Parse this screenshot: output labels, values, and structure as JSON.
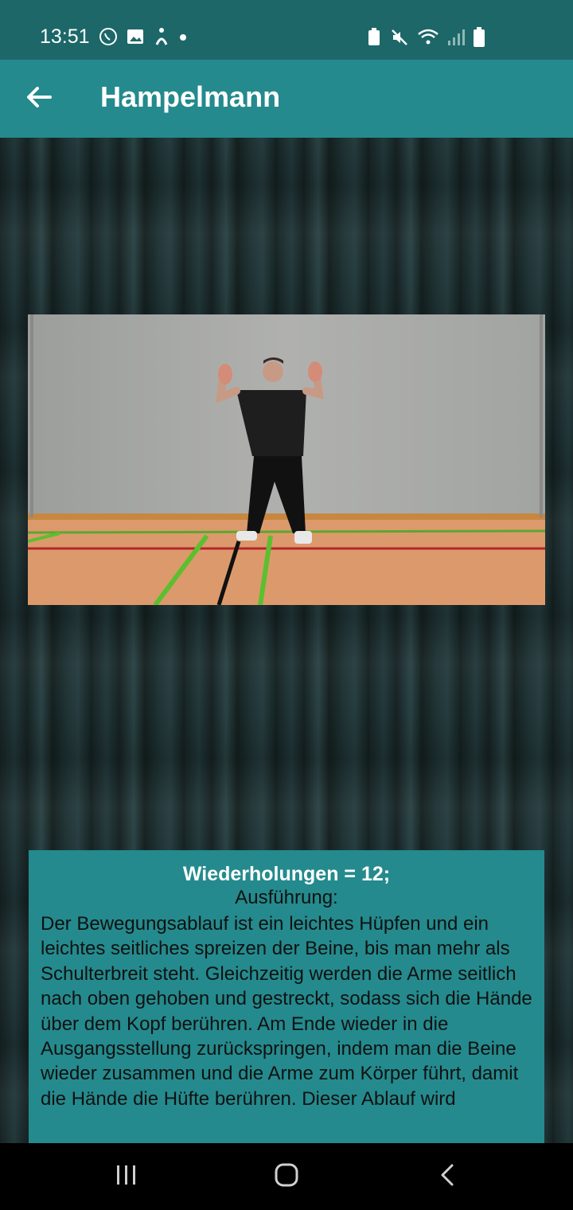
{
  "status_bar": {
    "time": "13:51",
    "left_icons": [
      "whatsapp-icon",
      "gallery-icon",
      "accessibility-icon",
      "dot-icon"
    ],
    "right_icons": [
      "battery-saver-icon",
      "mute-icon",
      "wifi-icon",
      "signal-icon",
      "battery-icon"
    ]
  },
  "app_bar": {
    "back_icon": "arrow-left-icon",
    "title": "Hampelmann"
  },
  "exercise": {
    "image_alt": "person doing jumping jack in gym hall"
  },
  "info": {
    "reps": "Wiederholungen = 12;",
    "execution_label": "Ausführung:",
    "description": "Der Bewegungsablauf ist ein leichtes Hüpfen und ein leichtes seitliches spreizen der Beine, bis man mehr als Schulterbreit steht. Gleichzeitig werden die Arme seitlich nach oben gehoben und gestreckt, sodass sich die Hände über dem Kopf berühren. Am Ende wieder in die Ausgangsstellung zurückspringen, indem man die Beine wieder zusammen und die Arme zum Körper führt, damit die Hände die Hüfte berühren. Dieser Ablauf wird"
  },
  "nav": {
    "recents_icon": "recents-icon",
    "home_icon": "home-icon",
    "back_icon": "nav-back-icon"
  },
  "colors": {
    "status_bar": "#1d6769",
    "app_bar": "#248a8d",
    "card": "#248a8d"
  }
}
